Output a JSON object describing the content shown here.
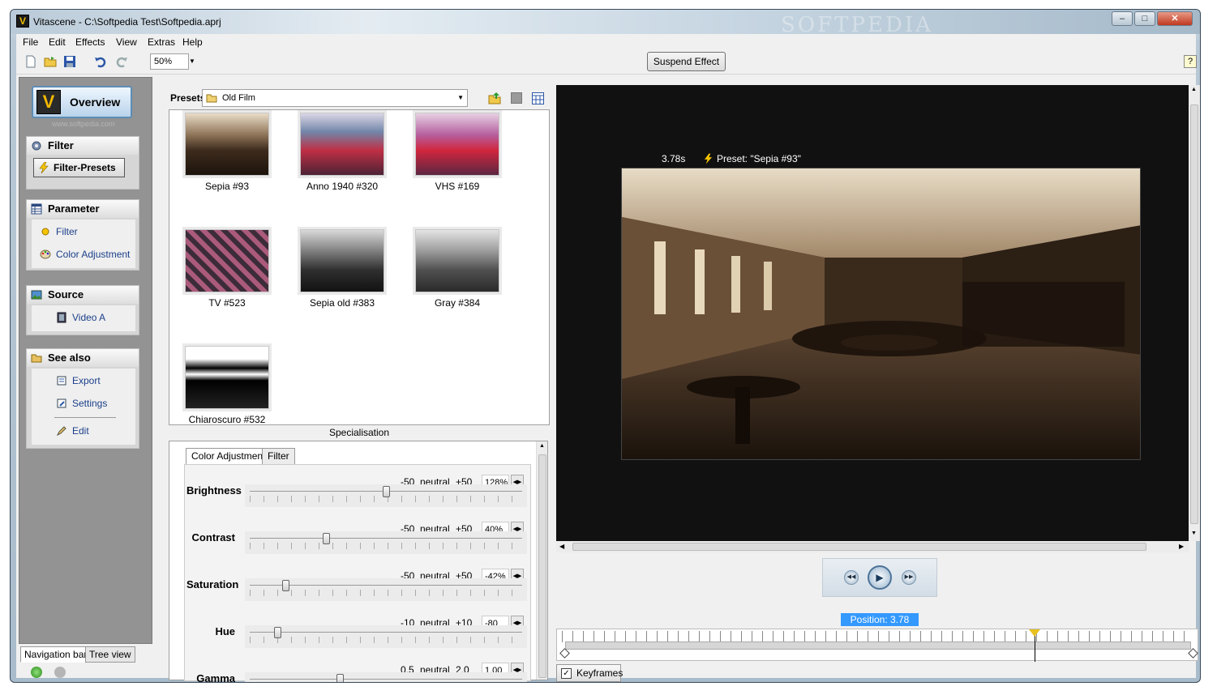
{
  "window": {
    "title": "Vitascene - C:\\Softpedia Test\\Softpedia.aprj",
    "app_icon": "V",
    "controls": {
      "minimize": "–",
      "maximize": "□",
      "close": "✕"
    }
  },
  "watermark": "SOFTPEDIA",
  "menu": [
    "File",
    "Edit",
    "Effects",
    "View",
    "Extras",
    "Help"
  ],
  "toolbar": {
    "zoom": "50%",
    "suspend_label": "Suspend Effect",
    "help": "?"
  },
  "nav": {
    "overview": "Overview",
    "overview_logo": "V",
    "www": "www.softpedia.com",
    "filter": {
      "title": "Filter",
      "presets_btn": "Filter-Presets"
    },
    "parameter": {
      "title": "Parameter",
      "items": [
        "Filter",
        "Color Adjustment"
      ]
    },
    "source": {
      "title": "Source",
      "items": [
        "Video A"
      ]
    },
    "see_also": {
      "title": "See also",
      "items": [
        "Export",
        "Settings",
        "Edit"
      ]
    },
    "tabs": [
      "Navigation bar",
      "Tree view"
    ]
  },
  "presets": {
    "label": "Presets",
    "folder": "Old Film",
    "items": [
      "Sepia #93",
      "Anno 1940 #320",
      "VHS #169",
      "TV #523",
      "Sepia old #383",
      "Gray #384",
      "Chiaroscuro #532"
    ]
  },
  "specialisation": {
    "label": "Specialisation",
    "tabs": [
      "Color Adjustment",
      "Filter"
    ],
    "params": [
      {
        "name": "Brightness",
        "min": "-50",
        "mid": "neutral",
        "max": "+50",
        "value": "128%",
        "pos": 0.5
      },
      {
        "name": "Contrast",
        "min": "-50",
        "mid": "neutral",
        "max": "+50",
        "value": "40%",
        "pos": 0.28
      },
      {
        "name": "Saturation",
        "min": "-50",
        "mid": "neutral",
        "max": "+50",
        "value": "-42%",
        "pos": 0.13
      },
      {
        "name": "Hue",
        "min": "-10",
        "mid": "neutral",
        "max": "+10",
        "value": "-80",
        "pos": 0.1
      },
      {
        "name": "Gamma",
        "min": "0.5",
        "mid": "neutral",
        "max": "2.0",
        "value": "1.00",
        "pos": 0.33
      }
    ]
  },
  "viewer": {
    "time": "3.78s",
    "preset": "Preset: \"Sepia #93\""
  },
  "playback": {
    "position": "Position: 3.78 sec.",
    "keyframes": "Keyframes",
    "marker_pos": 0.75
  },
  "colors": {
    "accent": "#3399ff",
    "sepia": "#6b4e30",
    "viewer_bg": "#111111",
    "nav_bg": "#939393"
  }
}
